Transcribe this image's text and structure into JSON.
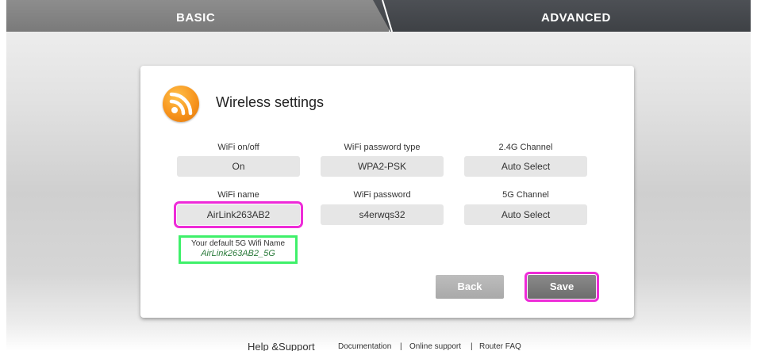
{
  "nav": {
    "basic_label": "BASIC",
    "advanced_label": "ADVANCED"
  },
  "card": {
    "title": "Wireless settings",
    "icon": "rss-wireless-icon"
  },
  "fields": {
    "wifi_onoff_label": "WiFi on/off",
    "wifi_onoff_value": "On",
    "password_type_label": "WiFi password type",
    "password_type_value": "WPA2-PSK",
    "channel_24_label": "2.4G Channel",
    "channel_24_value": "Auto Select",
    "wifi_name_label": "WiFi name",
    "wifi_name_value": "AirLink263AB2",
    "wifi_password_label": "WiFi password",
    "wifi_password_value": "s4erwqs32",
    "channel_5_label": "5G Channel",
    "channel_5_value": "Auto Select"
  },
  "default_5g": {
    "caption": "Your default 5G Wifi Name",
    "name": "AirLink263AB2_5G"
  },
  "buttons": {
    "back": "Back",
    "save": "Save"
  },
  "footer": {
    "help": "Help &Support",
    "documentation": "Documentation",
    "online_support": "Online support",
    "router_faq": "Router FAQ",
    "separator": "|"
  },
  "colors": {
    "highlight_pink": "#ee2bd8",
    "highlight_green": "#3ff06a",
    "icon_orange": "#f7941d"
  }
}
